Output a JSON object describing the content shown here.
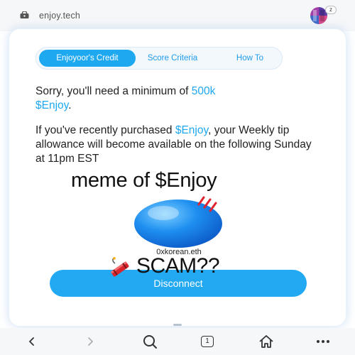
{
  "browser": {
    "url": "enjoy.tech",
    "avatar_badge": "z"
  },
  "tabs": [
    {
      "label": "Enjoyoor's Credit",
      "active": true
    },
    {
      "label": "Score Criteria",
      "active": false
    },
    {
      "label": "How To",
      "active": false
    }
  ],
  "message": {
    "line1_prefix": "Sorry, you'll need a minimum of ",
    "line1_highlight": "500k",
    "line1_highlight2": "$Enjoy",
    "line1_suffix": ".",
    "line2_prefix": "If you've recently purchased ",
    "line2_highlight": "$Enjoy",
    "line2_suffix": ", your Weekly tip allowance will become available on the following Sunday at 11pm EST"
  },
  "overlay": {
    "meme_title": "meme of $Enjoy",
    "scam_text": "SCAM??"
  },
  "account": {
    "handle": "0xkorean.eth"
  },
  "actions": {
    "disconnect_label": "Disconnect"
  },
  "bottom_nav": {
    "tab_count": "1"
  },
  "colors": {
    "accent": "#1ea8f0",
    "button": "#23a9f2"
  }
}
